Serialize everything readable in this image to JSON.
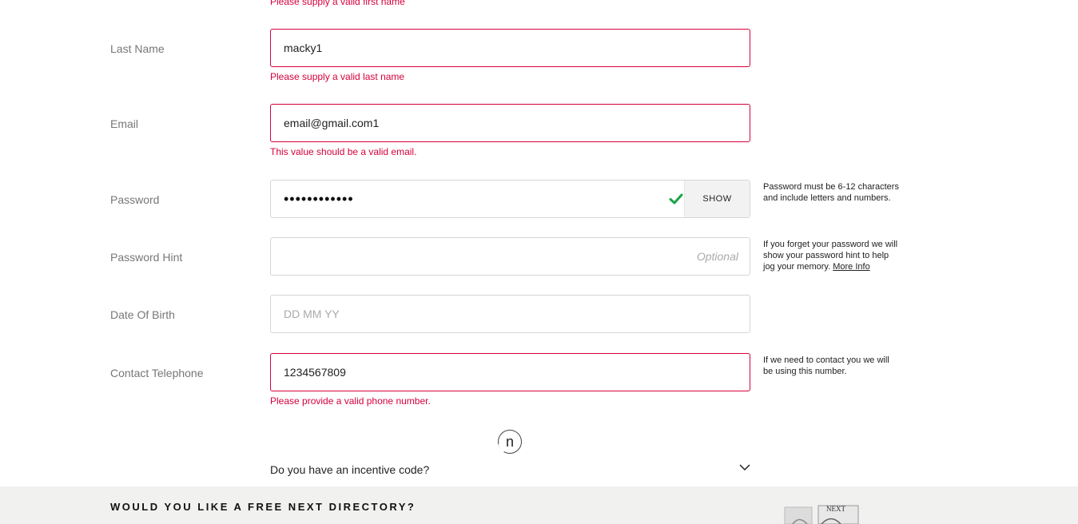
{
  "first_name": {
    "error": "Please supply a valid first name"
  },
  "last_name": {
    "label": "Last Name",
    "value": "macky1",
    "error": "Please supply a valid last name"
  },
  "email": {
    "label": "Email",
    "value": "email@gmail.com1",
    "error": "This value should be a valid email."
  },
  "password": {
    "label": "Password",
    "masked_value": "••••••••••••",
    "show_label": "SHOW",
    "help": "Password must be 6-12 characters and include letters and numbers.",
    "valid_color": "#1aa34a"
  },
  "password_hint": {
    "label": "Password Hint",
    "optional_text": "Optional",
    "help": "If you forget your password we will show your password hint to help jog your memory.",
    "more_info": "More Info"
  },
  "dob": {
    "label": "Date Of Birth",
    "placeholder": "DD MM YY"
  },
  "telephone": {
    "label": "Contact Telephone",
    "value": "1234567809",
    "error": "Please provide a valid phone number.",
    "help": "If we need to contact you we will be using this number."
  },
  "loader": {
    "glyph": "n"
  },
  "incentive": {
    "text": "Do you have an incentive code?"
  },
  "directory_banner": {
    "title": "WOULD YOU LIKE A FREE NEXT DIRECTORY?",
    "catalog_brand": "NEXT"
  },
  "colors": {
    "error": "#d6003c",
    "border": "#d6d6d6",
    "banner_bg": "#f1f1ef"
  }
}
